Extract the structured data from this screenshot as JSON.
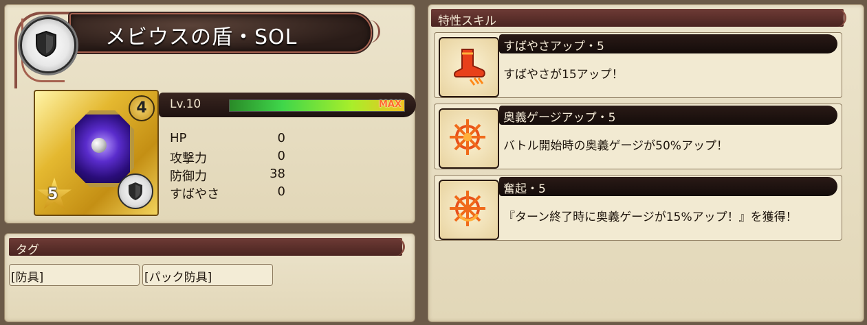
{
  "item": {
    "name": "メビウスの盾・SOL",
    "rarity_stars": "5",
    "card_level": "4",
    "level_label": "Lv.10",
    "level_max_label": "MAX",
    "level_progress": 1.0
  },
  "stats": [
    {
      "label": "HP",
      "value": "0"
    },
    {
      "label": "攻撃力",
      "value": "0"
    },
    {
      "label": "防御力",
      "value": "38"
    },
    {
      "label": "すばやさ",
      "value": "0"
    }
  ],
  "tags_section": {
    "title": "タグ",
    "tags": [
      "[防具]",
      "[パック防具]"
    ]
  },
  "skills_section": {
    "title": "特性スキル",
    "skills": [
      {
        "title": "すばやさアップ・5",
        "description": "すばやさが15アップ！",
        "icon": "boot-icon"
      },
      {
        "title": "奥義ゲージアップ・5",
        "description": "バトル開始時の奥義ゲージが50%アップ！",
        "icon": "sun-rune-icon"
      },
      {
        "title": "奮起・5",
        "description": "『ターン終了時に奥義ゲージが15%アップ！』を獲得！",
        "icon": "sun-rune-icon"
      }
    ]
  },
  "colors": {
    "header_bar": "#5a2d29",
    "gold_card": "#e4b830",
    "level_bar_green": "#3fd64a"
  }
}
